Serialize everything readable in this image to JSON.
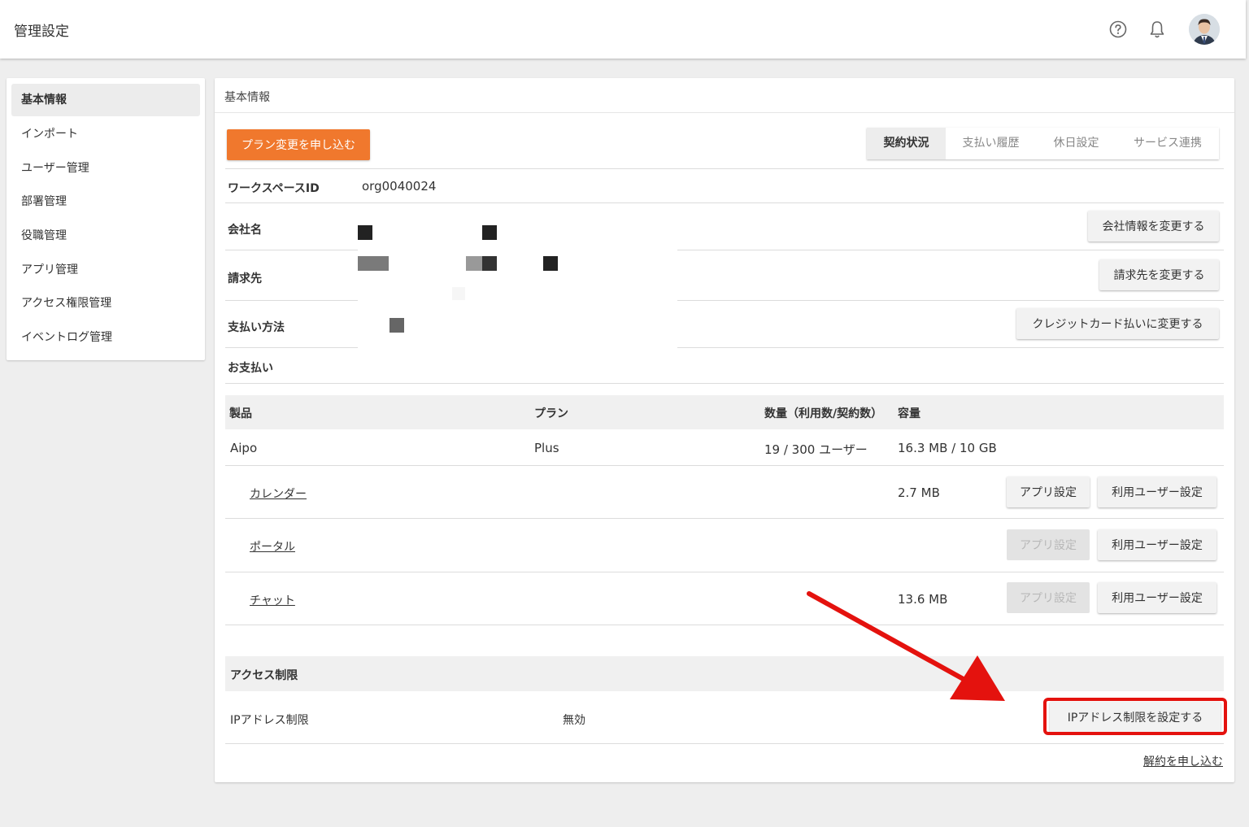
{
  "header": {
    "title": "管理設定",
    "icons": [
      "help-circle-icon",
      "bell-icon",
      "user-avatar"
    ]
  },
  "sidebar": {
    "items": [
      {
        "label": "基本情報",
        "active": true
      },
      {
        "label": "インポート"
      },
      {
        "label": "ユーザー管理"
      },
      {
        "label": "部署管理"
      },
      {
        "label": "役職管理"
      },
      {
        "label": "アプリ管理"
      },
      {
        "label": "アクセス権限管理"
      },
      {
        "label": "イベントログ管理"
      }
    ]
  },
  "panel": {
    "title": "基本情報",
    "plan_change_button": "プラン変更を申し込む",
    "tabs": [
      {
        "label": "契約状況",
        "active": true
      },
      {
        "label": "支払い履歴"
      },
      {
        "label": "休日設定"
      },
      {
        "label": "サービス連携"
      }
    ]
  },
  "info": {
    "workspace_id_label": "ワークスペースID",
    "workspace_id_value": "org0040024",
    "company_label": "会社名",
    "company_button": "会社情報を変更する",
    "billing_label": "請求先",
    "billing_button": "請求先を変更する",
    "payment_label": "支払い方法",
    "payment_button": "クレジットカード払いに変更する",
    "payment_section_label": "お支払い"
  },
  "products": {
    "headers": [
      "製品",
      "プラン",
      "数量（利用数/契約数）",
      "容量"
    ],
    "main_row": {
      "product": "Aipo",
      "plan": "Plus",
      "quantity": "19 / 300 ユーザー",
      "capacity": "16.3 MB / 10 GB"
    },
    "apps": [
      {
        "name": "カレンダー",
        "capacity": "2.7 MB",
        "app_settings": "アプリ設定",
        "app_settings_enabled": true,
        "user_settings": "利用ユーザー設定"
      },
      {
        "name": "ポータル",
        "capacity": "",
        "app_settings": "アプリ設定",
        "app_settings_enabled": false,
        "user_settings": "利用ユーザー設定"
      },
      {
        "name": "チャット",
        "capacity": "13.6 MB",
        "app_settings": "アプリ設定",
        "app_settings_enabled": false,
        "user_settings": "利用ユーザー設定"
      }
    ]
  },
  "access": {
    "section_label": "アクセス制限",
    "ip_label": "IPアドレス制限",
    "ip_status": "無効",
    "ip_button": "IPアドレス制限を設定する",
    "cancel_link": "解約を申し込む"
  },
  "annotation": {
    "highlight_color": "#e4120e"
  },
  "colors": {
    "accent": "#f0782d",
    "annotation": "#e4120e"
  }
}
